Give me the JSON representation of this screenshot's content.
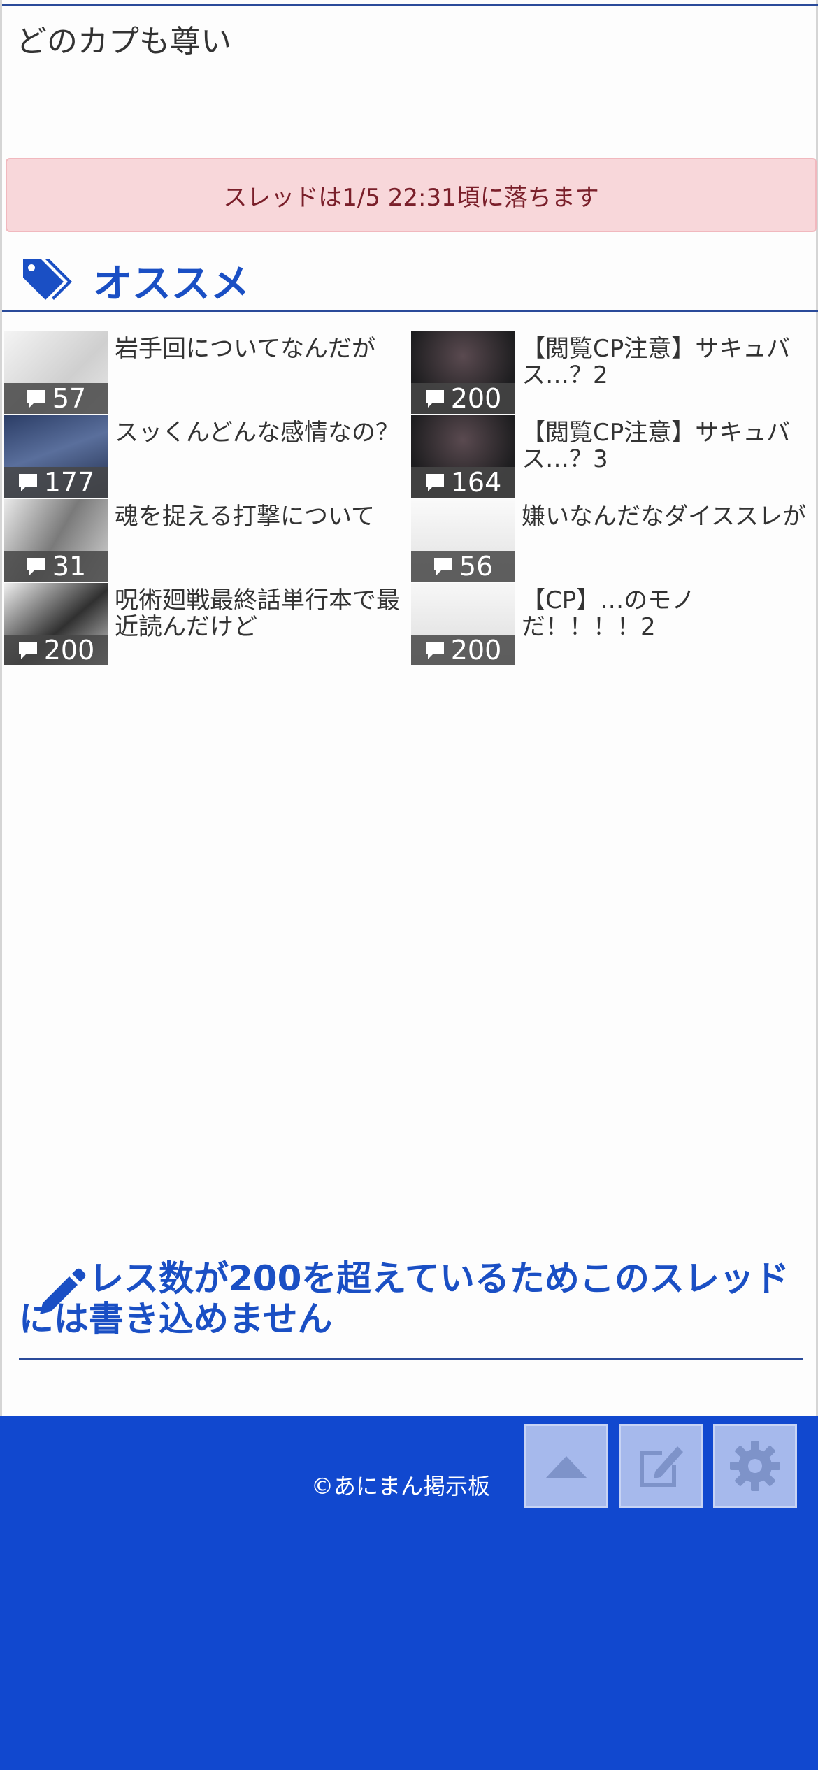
{
  "post": {
    "body": "どのカプも尊い"
  },
  "alert": {
    "text": "スレッドは1/5 22:31頃に落ちます"
  },
  "recommend": {
    "title": "オススメ",
    "items": [
      {
        "title": "岩手回についてなんだが",
        "count": "57",
        "thumb": "light"
      },
      {
        "title": "【閲覧CP注意】サキュバス…？2",
        "count": "200",
        "thumb": "dark"
      },
      {
        "title": "スッくんどんな感情なの？",
        "count": "177",
        "thumb": "blue"
      },
      {
        "title": "【閲覧CP注意】サキュバス…？3",
        "count": "164",
        "thumb": "dark"
      },
      {
        "title": "魂を捉える打撃について",
        "count": "31",
        "thumb": "mid"
      },
      {
        "title": "嫌いなんだなダイススレが",
        "count": "56",
        "thumb": "light"
      },
      {
        "title": "呪術廻戦最終話単行本で最近読んだけど",
        "count": "200",
        "thumb": "mid"
      },
      {
        "title": "【CP】…のモノだ！！！！2",
        "count": "200",
        "thumb": "light"
      }
    ]
  },
  "closed_notice": {
    "text": "レス数が200を超えているためこのスレッドには書き込めません"
  },
  "footer": {
    "copyright": "©あにまん掲示板"
  },
  "colors": {
    "accent": "#1a4fc4",
    "footer_bg": "#1148cf",
    "alert_bg": "#f8d7da"
  },
  "icons": [
    "tag-icon",
    "comment-icon",
    "pencil-icon",
    "caret-up-icon",
    "edit-icon",
    "gear-icon"
  ]
}
